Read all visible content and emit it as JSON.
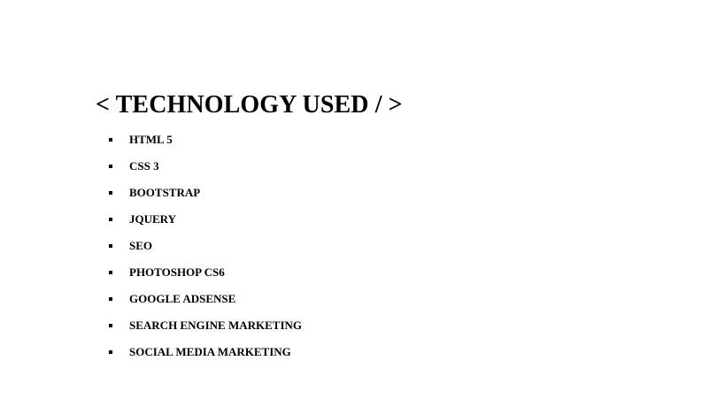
{
  "section": {
    "title": "< TECHNOLOGY USED / >"
  },
  "technologies": [
    "HTML 5",
    "CSS 3",
    "BOOTSTRAP",
    "JQUERY",
    "SEO",
    "PHOTOSHOP CS6",
    "GOOGLE ADSENSE",
    "SEARCH ENGINE MARKETING",
    "SOCIAL MEDIA MARKETING"
  ]
}
